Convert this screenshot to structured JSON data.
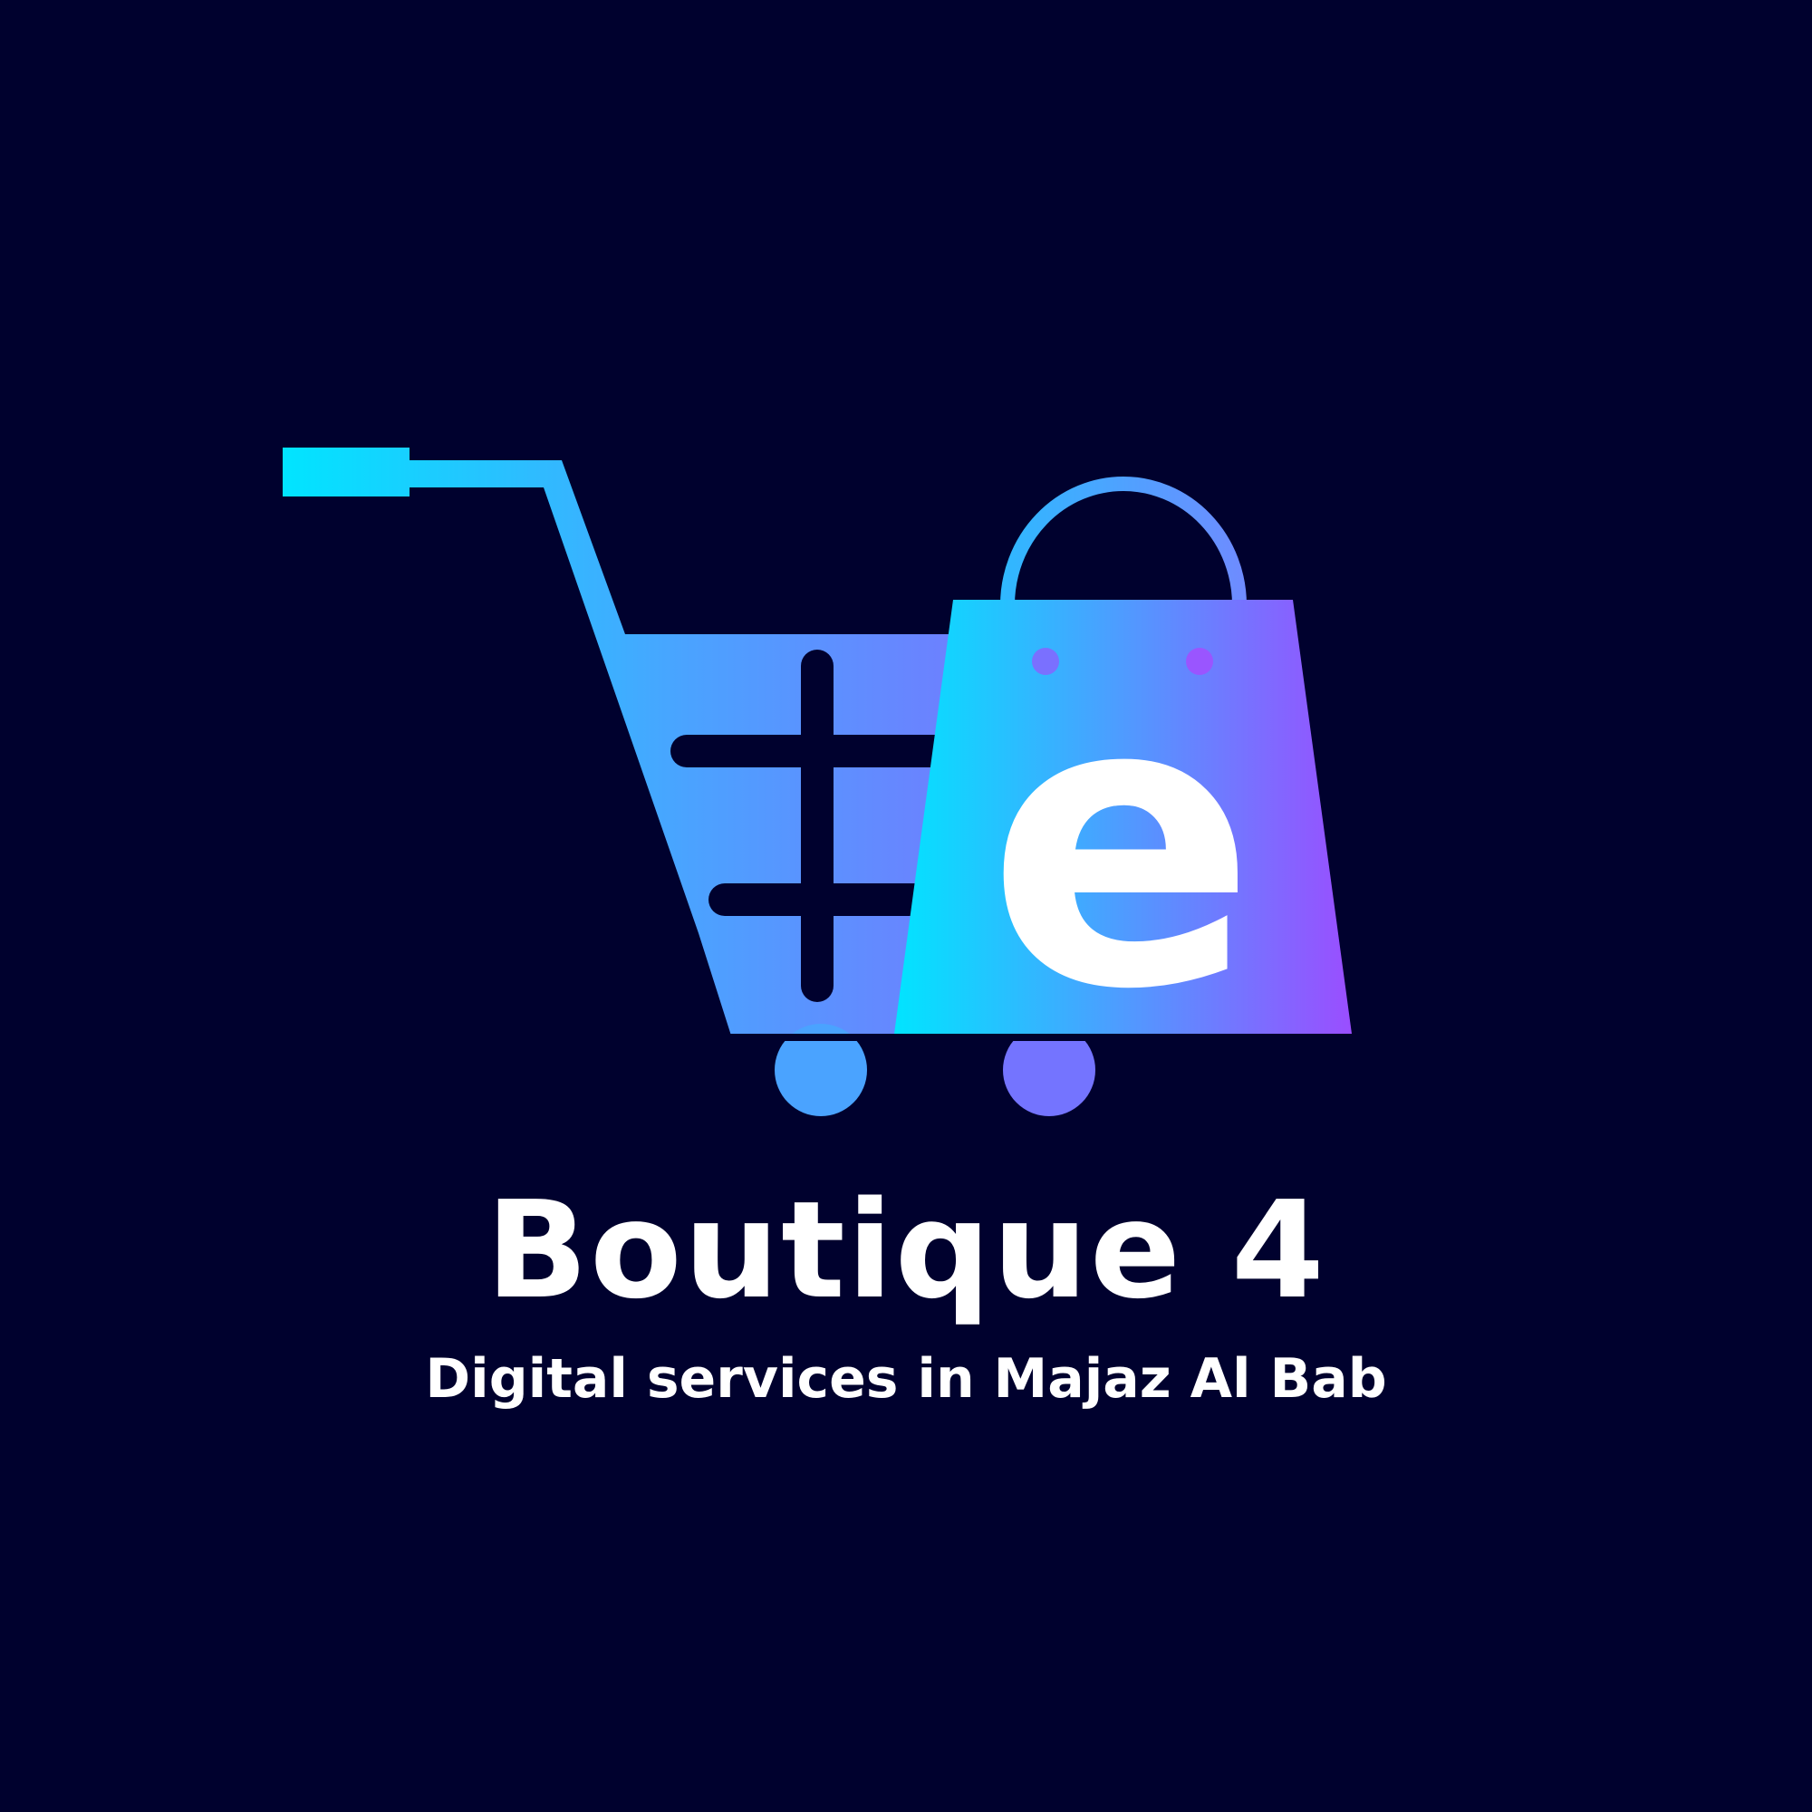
{
  "brand": {
    "name": "Boutique 4",
    "tagline": "Digital services in Majaz Al Bab",
    "logo_letter": "e",
    "logo_icon": "shopping-cart-with-bag-icon"
  },
  "colors": {
    "background": "#00012e",
    "gradient_start": "#00e5ff",
    "gradient_mid": "#4aa3ff",
    "gradient_end": "#9b4dff",
    "text": "#ffffff"
  }
}
